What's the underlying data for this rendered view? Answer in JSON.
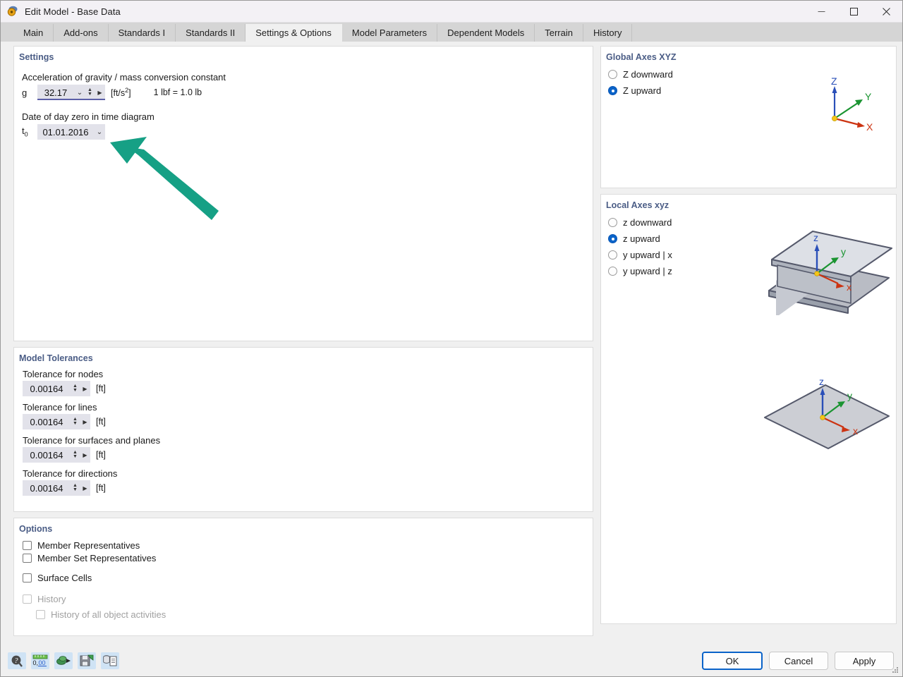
{
  "window": {
    "title": "Edit Model - Base Data",
    "icon": "app-model-icon",
    "minimize": "–",
    "maximize": "□",
    "close": "✕"
  },
  "tabs": [
    {
      "label": "Main",
      "active": false
    },
    {
      "label": "Add-ons",
      "active": false
    },
    {
      "label": "Standards I",
      "active": false
    },
    {
      "label": "Standards II",
      "active": false
    },
    {
      "label": "Settings & Options",
      "active": true
    },
    {
      "label": "Model Parameters",
      "active": false
    },
    {
      "label": "Dependent Models",
      "active": false
    },
    {
      "label": "Terrain",
      "active": false
    },
    {
      "label": "History",
      "active": false
    }
  ],
  "settings": {
    "title": "Settings",
    "gravity_label": "Acceleration of gravity / mass conversion constant",
    "gravity_symbol": "g",
    "gravity_value": "32.17",
    "gravity_unit": "[ft/s",
    "gravity_unit_exp": "2",
    "gravity_unit_close": "]",
    "gravity_note": "1 lbf = 1.0 lb",
    "date_label": "Date of day zero in time diagram",
    "date_symbol": "t",
    "date_symbol_sub": "0",
    "date_value": "01.01.2016"
  },
  "model_tolerances": {
    "title": "Model Tolerances",
    "items": [
      {
        "label": "Tolerance for nodes",
        "value": "0.00164",
        "unit": "[ft]"
      },
      {
        "label": "Tolerance for lines",
        "value": "0.00164",
        "unit": "[ft]"
      },
      {
        "label": "Tolerance for surfaces and planes",
        "value": "0.00164",
        "unit": "[ft]"
      },
      {
        "label": "Tolerance for directions",
        "value": "0.00164",
        "unit": "[ft]"
      }
    ]
  },
  "options": {
    "title": "Options",
    "items": [
      {
        "label": "Member Representatives",
        "checked": false,
        "disabled": false,
        "indent": 0
      },
      {
        "label": "Member Set Representatives",
        "checked": false,
        "disabled": false,
        "indent": 0
      },
      {
        "label": "Surface Cells",
        "checked": false,
        "disabled": false,
        "indent": 0
      },
      {
        "label": "History",
        "checked": false,
        "disabled": true,
        "indent": 0
      },
      {
        "label": "History of all object activities",
        "checked": false,
        "disabled": true,
        "indent": 1
      }
    ]
  },
  "global_axes": {
    "title": "Global Axes XYZ",
    "options": [
      {
        "label": "Z downward",
        "selected": false
      },
      {
        "label": "Z upward",
        "selected": true
      }
    ],
    "diagram": {
      "z_label": "Z",
      "y_label": "Y",
      "x_label": "X",
      "origin_color": "#f5c518",
      "z_color": "#2a4fb8",
      "y_color": "#1a9431",
      "x_color": "#cc3311"
    }
  },
  "local_axes": {
    "title": "Local Axes xyz",
    "options": [
      {
        "label": "z downward",
        "selected": false
      },
      {
        "label": "z upward",
        "selected": true
      },
      {
        "label": "y upward | x",
        "selected": false
      },
      {
        "label": "y upward | z",
        "selected": false
      }
    ],
    "beam_diagram": {
      "z_label": "z",
      "y_label": "y",
      "x_label": "x",
      "shape": "i-beam"
    },
    "surface_diagram": {
      "z_label": "z",
      "y_label": "y",
      "x_label": "x",
      "shape": "plane"
    }
  },
  "footer": {
    "tools": [
      {
        "name": "help-icon",
        "glyph": "?"
      },
      {
        "name": "units-icon",
        "glyph": "0,00"
      },
      {
        "name": "settings-transfer-icon",
        "glyph": "▸"
      },
      {
        "name": "save-defaults-icon",
        "glyph": "💾"
      },
      {
        "name": "copy-to-clipboard-icon",
        "glyph": "▤"
      }
    ],
    "buttons": [
      {
        "label": "OK",
        "primary": true
      },
      {
        "label": "Cancel",
        "primary": false
      },
      {
        "label": "Apply",
        "primary": false
      }
    ]
  },
  "annotation": {
    "type": "arrow",
    "color": "#19a383",
    "points_to": "gravity-value-combo"
  }
}
